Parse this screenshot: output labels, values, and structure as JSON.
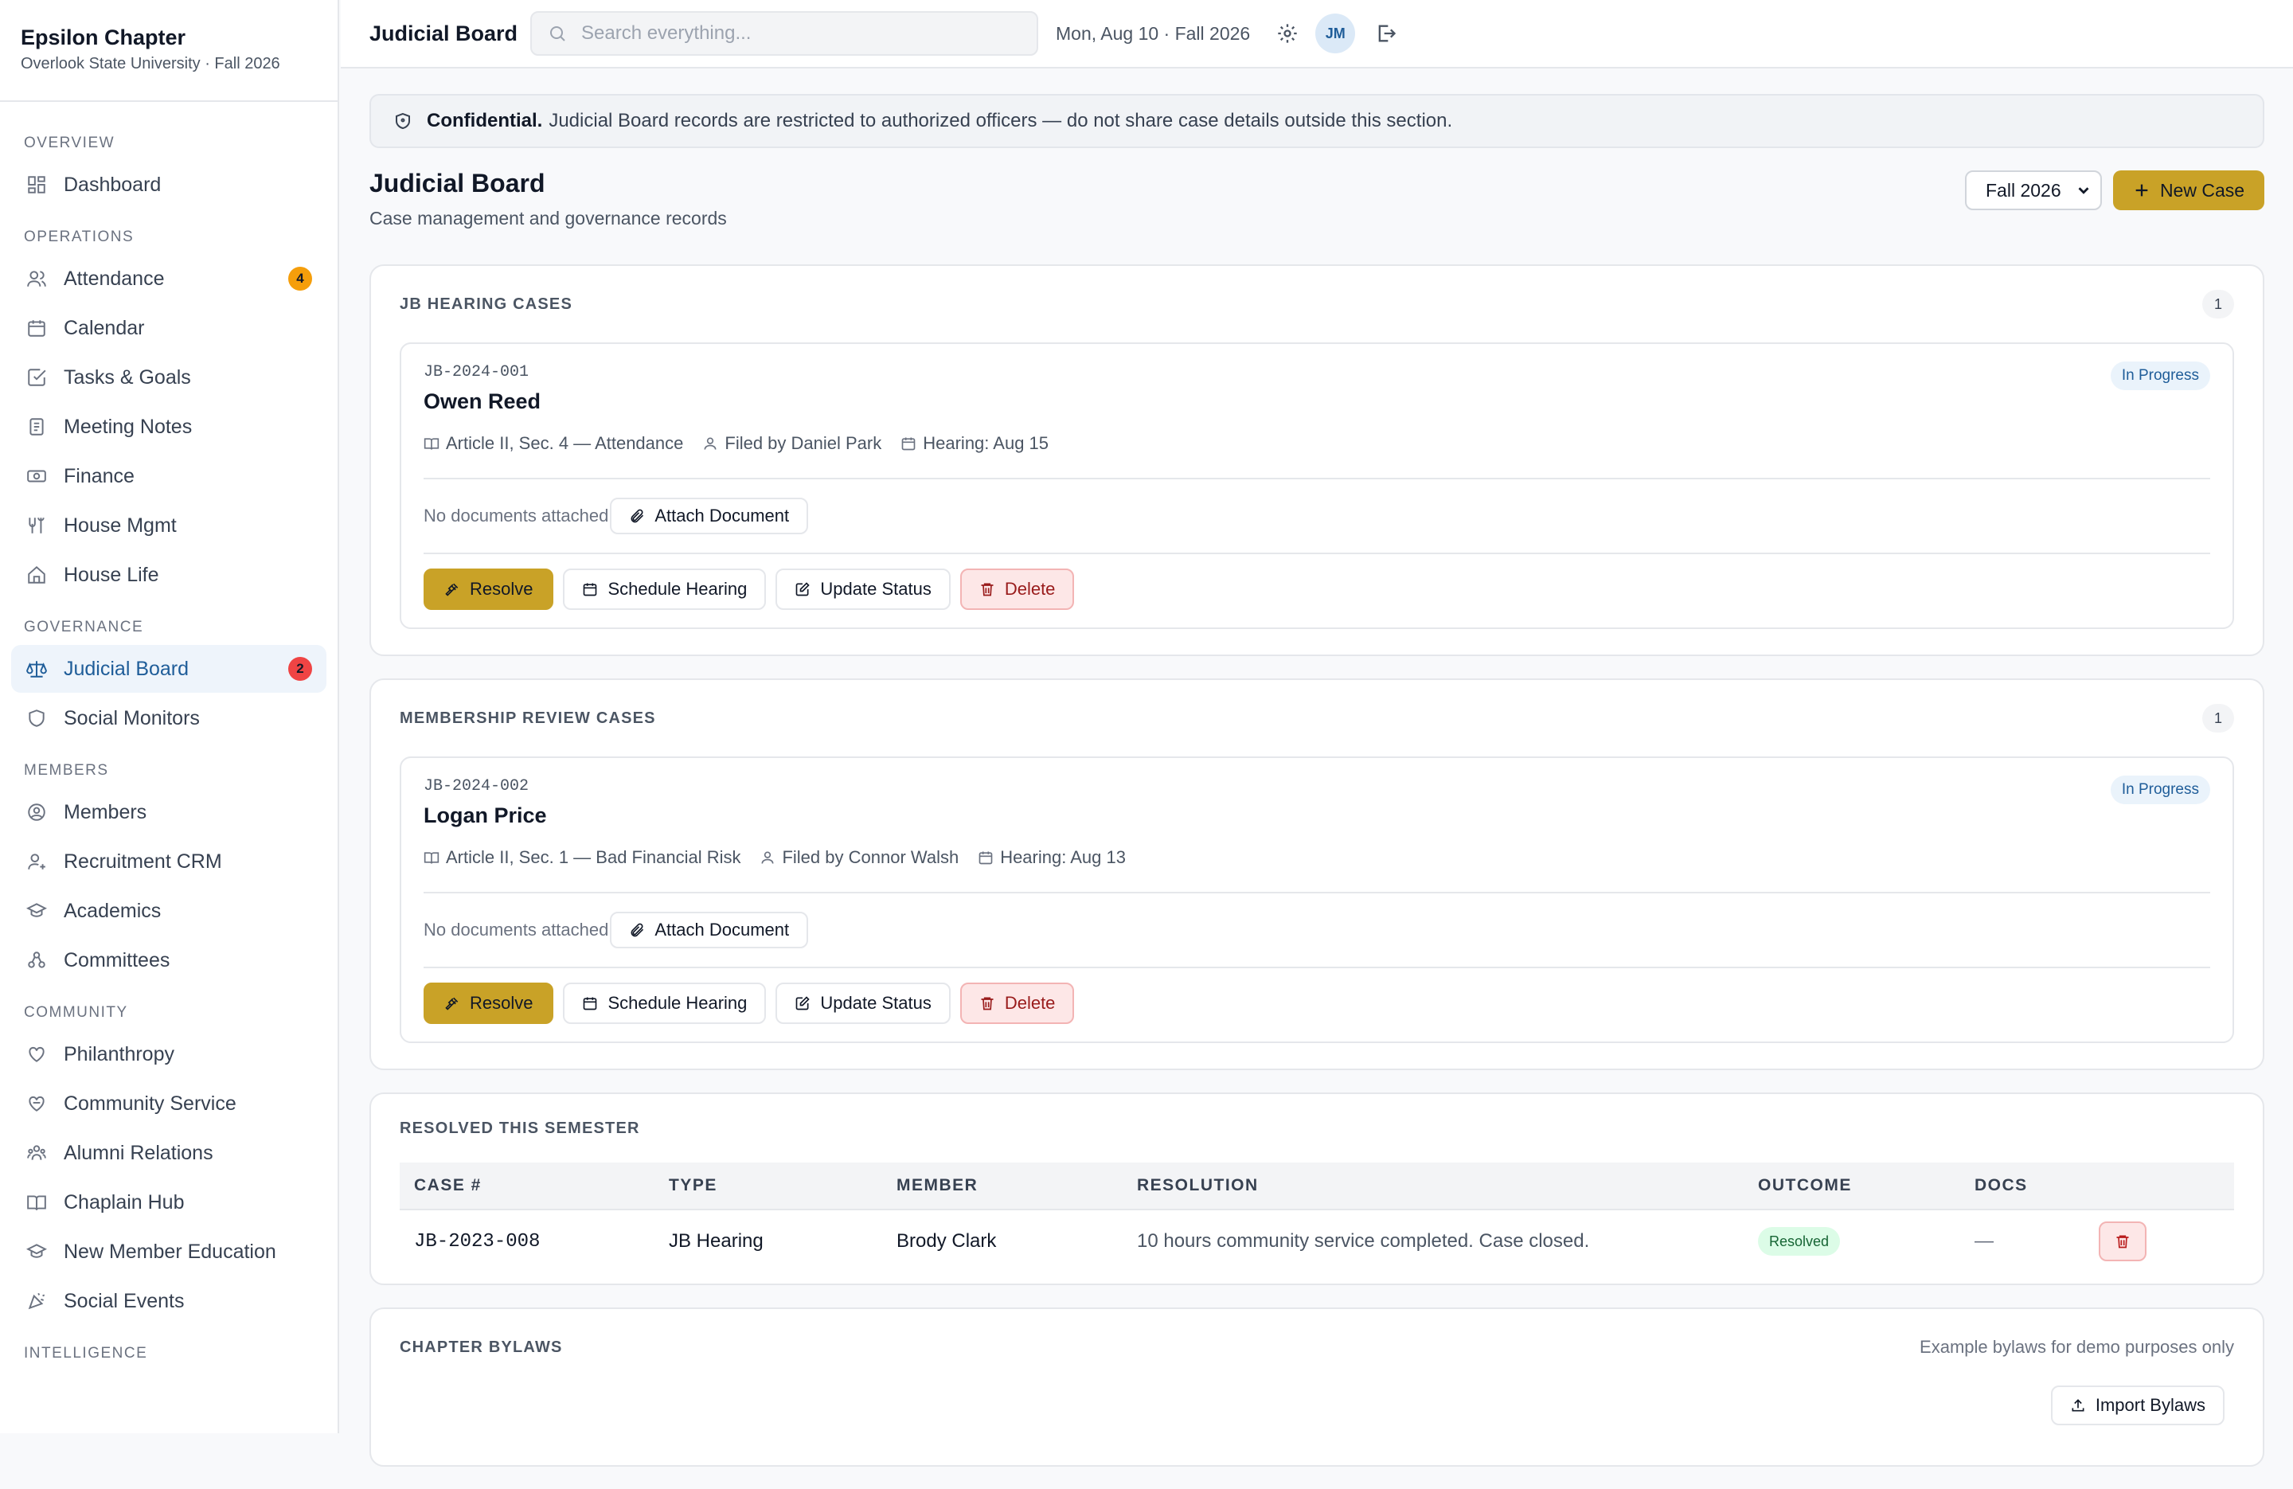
{
  "sidebar": {
    "brand": "Epsilon Chapter",
    "subtitle": "Overlook State University · Fall 2026",
    "sections": [
      {
        "label": "OVERVIEW",
        "items": [
          {
            "label": "Dashboard",
            "icon": "dashboard-icon"
          }
        ]
      },
      {
        "label": "OPERATIONS",
        "items": [
          {
            "label": "Attendance",
            "icon": "users-icon",
            "badge": "4"
          },
          {
            "label": "Calendar",
            "icon": "calendar-icon"
          },
          {
            "label": "Tasks & Goals",
            "icon": "check-square-icon"
          },
          {
            "label": "Meeting Notes",
            "icon": "notes-icon"
          },
          {
            "label": "Finance",
            "icon": "money-icon"
          },
          {
            "label": "House Mgmt",
            "icon": "tools-icon"
          },
          {
            "label": "House Life",
            "icon": "home-icon"
          }
        ]
      },
      {
        "label": "GOVERNANCE",
        "items": [
          {
            "label": "Judicial Board",
            "icon": "scale-icon",
            "badge": "2",
            "active": true
          },
          {
            "label": "Social Monitors",
            "icon": "shield-icon"
          }
        ]
      },
      {
        "label": "MEMBERS",
        "items": [
          {
            "label": "Members",
            "icon": "user-circle-icon"
          },
          {
            "label": "Recruitment CRM",
            "icon": "user-plus-icon"
          },
          {
            "label": "Academics",
            "icon": "graduation-cap-icon"
          },
          {
            "label": "Committees",
            "icon": "committee-icon"
          }
        ]
      },
      {
        "label": "COMMUNITY",
        "items": [
          {
            "label": "Philanthropy",
            "icon": "heart-icon"
          },
          {
            "label": "Community Service",
            "icon": "handshake-heart-icon"
          },
          {
            "label": "Alumni Relations",
            "icon": "group-icon"
          },
          {
            "label": "Chaplain Hub",
            "icon": "book-icon"
          },
          {
            "label": "New Member Education",
            "icon": "graduation-cap-icon"
          },
          {
            "label": "Social Events",
            "icon": "party-icon"
          }
        ]
      },
      {
        "label": "INTELLIGENCE",
        "items": []
      }
    ]
  },
  "topbar": {
    "title": "Judicial Board",
    "search_placeholder": "Search everything...",
    "date": "Mon, Aug 10 · Fall 2026",
    "avatar_initials": "JM"
  },
  "notice": {
    "strong": "Confidential.",
    "text": "Judicial Board records are restricted to authorized officers — do not share case details outside this section."
  },
  "page": {
    "title": "Judicial Board",
    "subtitle": "Case management and governance records",
    "semester": "Fall 2026",
    "new_case": "New Case"
  },
  "jb_cases": {
    "label": "JB HEARING CASES",
    "count": "1",
    "case": {
      "id": "JB-2024-001",
      "name": "Owen Reed",
      "status": "In Progress",
      "article": "Article II, Sec. 4 — Attendance",
      "filed_by": "Filed by Daniel Park",
      "hearing": "Hearing: Aug 15",
      "no_docs": "No documents attached"
    }
  },
  "mr_cases": {
    "label": "MEMBERSHIP REVIEW CASES",
    "count": "1",
    "case": {
      "id": "JB-2024-002",
      "name": "Logan Price",
      "status": "In Progress",
      "article": "Article II, Sec. 1 — Bad Financial Risk",
      "filed_by": "Filed by Connor Walsh",
      "hearing": "Hearing: Aug 13",
      "no_docs": "No documents attached"
    }
  },
  "buttons": {
    "attach": "Attach Document",
    "resolve": "Resolve",
    "schedule": "Schedule Hearing",
    "update": "Update Status",
    "delete": "Delete"
  },
  "resolved": {
    "label": "RESOLVED THIS SEMESTER",
    "headers": [
      "CASE #",
      "TYPE",
      "MEMBER",
      "RESOLUTION",
      "OUTCOME",
      "DOCS"
    ],
    "rows": [
      {
        "case": "JB-2023-008",
        "type": "JB Hearing",
        "member": "Brody Clark",
        "resolution": "10 hours community service completed. Case closed.",
        "outcome": "Resolved",
        "docs": "—"
      }
    ]
  },
  "bylaws": {
    "label": "CHAPTER BYLAWS",
    "note": "Example bylaws for demo purposes only",
    "import": "Import Bylaws"
  },
  "colors": {
    "accent_gold": "#c9a227",
    "active_blue": "#1f5d99",
    "danger_red": "#ef4444",
    "badge_orange": "#f59e0b"
  }
}
